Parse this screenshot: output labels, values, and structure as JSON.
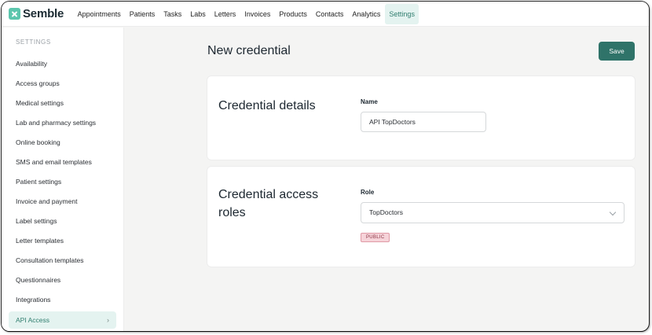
{
  "app": {
    "logo_text": "Semble"
  },
  "nav": {
    "items": [
      {
        "label": "Appointments"
      },
      {
        "label": "Patients"
      },
      {
        "label": "Tasks"
      },
      {
        "label": "Labs"
      },
      {
        "label": "Letters"
      },
      {
        "label": "Invoices"
      },
      {
        "label": "Products"
      },
      {
        "label": "Contacts"
      },
      {
        "label": "Analytics"
      },
      {
        "label": "Settings"
      }
    ],
    "active": "Settings"
  },
  "sidebar": {
    "heading": "SETTINGS",
    "items": [
      {
        "label": "Availability"
      },
      {
        "label": "Access groups"
      },
      {
        "label": "Medical settings"
      },
      {
        "label": "Lab and pharmacy settings"
      },
      {
        "label": "Online booking"
      },
      {
        "label": "SMS and email templates"
      },
      {
        "label": "Patient settings"
      },
      {
        "label": "Invoice and payment"
      },
      {
        "label": "Label settings"
      },
      {
        "label": "Letter templates"
      },
      {
        "label": "Consultation templates"
      },
      {
        "label": "Questionnaires"
      },
      {
        "label": "Integrations"
      },
      {
        "label": "API Access"
      }
    ],
    "active_chevron": "›"
  },
  "main": {
    "title": "New credential",
    "save_label": "Save",
    "details_card": {
      "title": "Credential details",
      "name_label": "Name",
      "name_value": "API TopDoctors"
    },
    "roles_card": {
      "title": "Credential access roles",
      "role_label": "Role",
      "role_value": "TopDoctors",
      "badge": "PUBLIC"
    }
  },
  "colors": {
    "accent": "#2f7369",
    "active_bg": "#e4f3f0",
    "active_text": "#2f7d6e",
    "badge_bg": "#f6d3d9",
    "badge_border": "#e09aa6"
  },
  "icons": {
    "logo": "semble-logo-icon",
    "select_chevron": "chevron-down-icon",
    "sidebar_chevron": "chevron-right-icon"
  }
}
